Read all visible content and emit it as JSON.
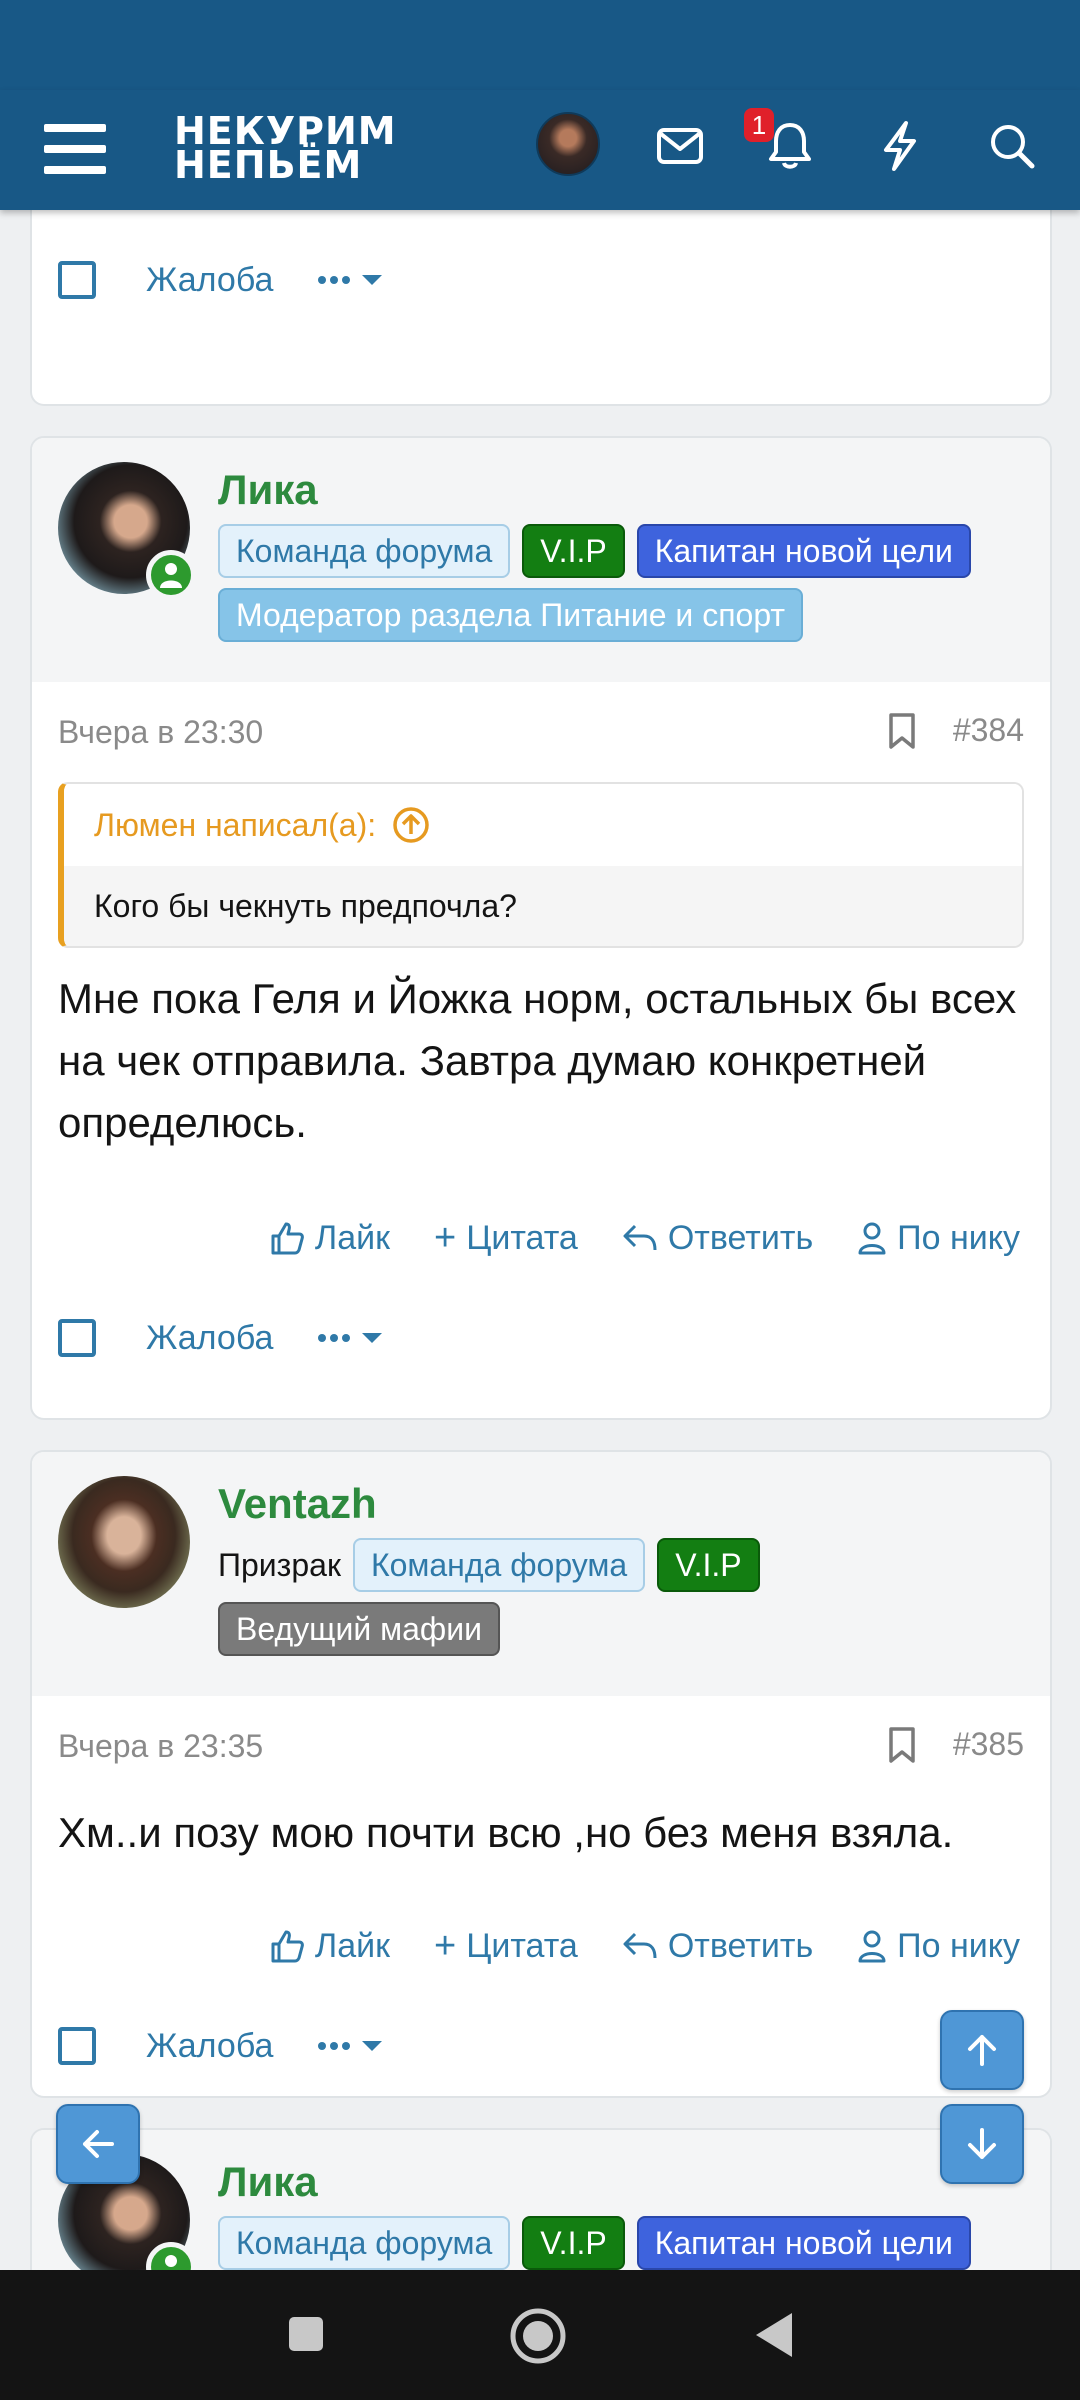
{
  "app": {
    "logo_line1": "НЕКУРИМ",
    "logo_line2": "НЕПЬЁМ",
    "notification_count": "1",
    "icons": [
      "menu-icon",
      "avatar",
      "mail-icon",
      "bell-icon",
      "lightning-icon",
      "search-icon"
    ],
    "colors": {
      "header": "#185886",
      "link": "#2f79a8",
      "username": "#2d8a3e",
      "quote_accent": "#e8a020"
    }
  },
  "actions": {
    "like": "Лайк",
    "quote": "Цитата",
    "reply": "Ответить",
    "by_nick": "По нику",
    "report": "Жалоба"
  },
  "posts": [
    {
      "username": "Лика",
      "badges": [
        "Команда форума",
        "V.I.P",
        "Капитан новой цели",
        "Модератор раздела Питание и спорт"
      ],
      "time": "Вчера в 23:30",
      "number": "#384",
      "quote_author": "Люмен написал(а):",
      "quote_text": "Кого бы чекнуть предпочла?",
      "text": "Мне пока Геля и Йожка норм, остальных бы всех на чек отправила. Завтра думаю конкретней определюсь."
    },
    {
      "username": "Ventazh",
      "title": "Призрак",
      "badges": [
        "Команда форума",
        "V.I.P",
        "Ведущий мафии"
      ],
      "time": "Вчера в 23:35",
      "number": "#385",
      "text": "Хм..и позу мою почти всю ,но без меня взяла."
    },
    {
      "username": "Лика",
      "badges": [
        "Команда форума",
        "V.I.P",
        "Капитан новой цели"
      ]
    }
  ]
}
